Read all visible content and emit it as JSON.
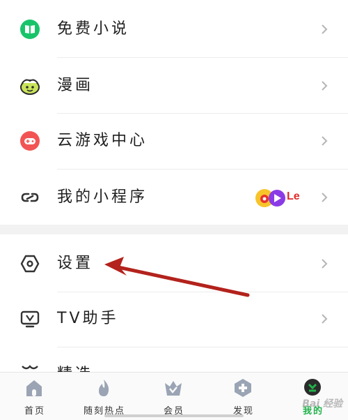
{
  "menu": {
    "items": [
      {
        "label": "免费小说",
        "icon": "book-icon"
      },
      {
        "label": "漫画",
        "icon": "comic-face-icon"
      },
      {
        "label": "云游戏中心",
        "icon": "gamepad-icon"
      },
      {
        "label": "我的小程序",
        "icon": "link-chain-icon",
        "badge_text": "Le"
      },
      {
        "label": "设置",
        "icon": "hexagon-settings-icon"
      },
      {
        "label": "TV助手",
        "icon": "tv-icon"
      },
      {
        "label": "精选",
        "icon": "partial-icon"
      }
    ]
  },
  "bottom_nav": {
    "tabs": [
      {
        "label": "首页",
        "icon": "home-icon",
        "active": false
      },
      {
        "label": "随刻热点",
        "icon": "flame-icon",
        "active": false
      },
      {
        "label": "会员",
        "icon": "crown-icon",
        "active": false
      },
      {
        "label": "发现",
        "icon": "discover-plus-icon",
        "active": false
      },
      {
        "label": "我的",
        "icon": "avatar-icon",
        "active": true
      }
    ],
    "active_color": "#21b24a"
  },
  "colors": {
    "novel_green": "#18c46a",
    "comic_yellow": "#c9e35a",
    "game_red": "#f25454",
    "arrow_red": "#b3221c"
  },
  "watermark": "Bai 经验"
}
